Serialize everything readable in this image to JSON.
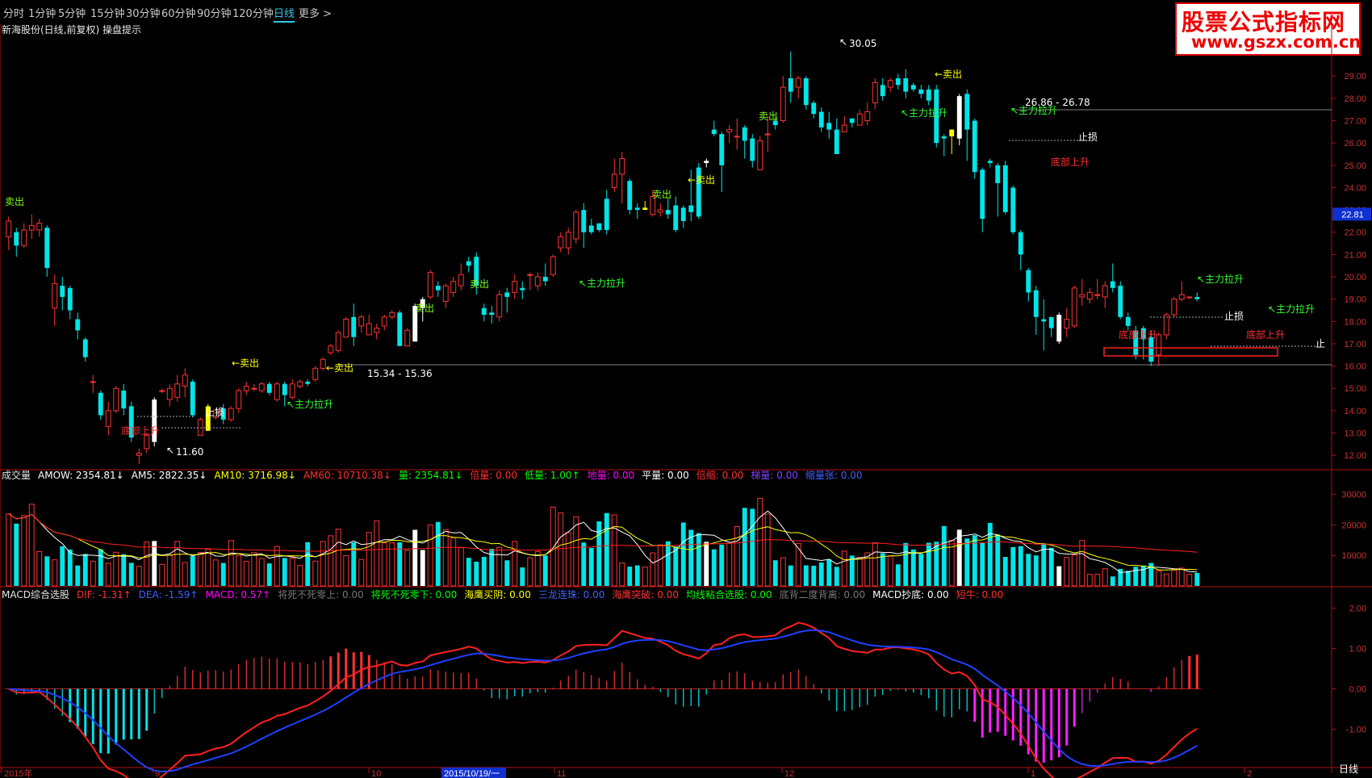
{
  "tabs": [
    "分时",
    "1分钟",
    "5分钟",
    "15分钟",
    "30分钟",
    "60分钟",
    "90分钟",
    "120分钟",
    "日线",
    "更多 >"
  ],
  "active_tab": "日线",
  "logo": {
    "line1": "股票公式指标网",
    "line2": "www.gszx.com.cn"
  },
  "title": "新海股份(日线,前复权) 操盘提示",
  "price_axis": {
    "ticks": [
      "29.00",
      "28.00",
      "27.00",
      "26.00",
      "25.00",
      "24.00",
      "23.00",
      "22.00",
      "21.00",
      "20.00",
      "19.00",
      "18.00",
      "17.00",
      "16.00",
      "15.00",
      "14.00",
      "13.00",
      "12.00"
    ],
    "current": "22.81"
  },
  "date_axis": [
    "2015年",
    "9",
    "10",
    "2015/10/19/一",
    "11",
    "12",
    "1",
    "2"
  ],
  "bottom_right": "日线",
  "volume_axis": [
    "30000",
    "20000",
    "10000"
  ],
  "macd_axis": [
    "2.00",
    "1.00",
    "0.00",
    "-1.00"
  ],
  "volume_header": [
    {
      "text": "成交量",
      "color": "#e6e6e6"
    },
    {
      "text": "AMOW: 2354.81↓",
      "color": "#ffffff"
    },
    {
      "text": "AM5: 2822.35↓",
      "color": "#ffffff"
    },
    {
      "text": "AM10: 3716.98↓",
      "color": "#ffff00"
    },
    {
      "text": "AM60: 10710.38↓",
      "color": "#ff3030"
    },
    {
      "text": "量: 2354.81↓",
      "color": "#00ff00"
    },
    {
      "text": "倍量: 0.00",
      "color": "#ff3030"
    },
    {
      "text": "低量: 1.00↑",
      "color": "#00ff00"
    },
    {
      "text": "地量: 0.00",
      "color": "#ff00ff"
    },
    {
      "text": "平量: 0.00",
      "color": "#ffffff"
    },
    {
      "text": "倍缩: 0.00",
      "color": "#ff3030"
    },
    {
      "text": "梯量: 0.00",
      "color": "#8040ff"
    },
    {
      "text": "缩量张: 0.00",
      "color": "#4060ff"
    }
  ],
  "macd_header": [
    {
      "text": "MACD综合选股",
      "color": "#e6e6e6"
    },
    {
      "text": "DIF: -1.31↑",
      "color": "#ff3030"
    },
    {
      "text": "DEA: -1.59↑",
      "color": "#4060ff"
    },
    {
      "text": "MACD: 0.57↑",
      "color": "#ff00ff"
    },
    {
      "text": "将死不死零上: 0.00",
      "color": "#777777"
    },
    {
      "text": "将死不死零下: 0.00",
      "color": "#00ff00"
    },
    {
      "text": "海鹰买阴: 0.00",
      "color": "#ffff00"
    },
    {
      "text": "三龙连珠: 0.00",
      "color": "#4060ff"
    },
    {
      "text": "海鹰突破: 0.00",
      "color": "#ff3030"
    },
    {
      "text": "均线粘合选股: 0.00",
      "color": "#00ff00"
    },
    {
      "text": "底背二度背离: 0.00",
      "color": "#777777"
    },
    {
      "text": "MACD抄底: 0.00",
      "color": "#ffffff"
    },
    {
      "text": "短牛: 0.00",
      "color": "#ff3030"
    }
  ],
  "annotations": {
    "sell": "←卖出",
    "sell_label": "卖出",
    "main_rise": "主力拉升",
    "stop_loss": "止损",
    "bottom_rise": "底部上升",
    "high": "30.05",
    "low": "11.60",
    "range1": "15.34 - 15.36",
    "range2": "26.86 - 26.78",
    "zhi": "止",
    "sell_green_1": "卖出",
    "sell_green_2": "卖出",
    "sell_green_3": "卖出",
    "sell_green_4": "卖出"
  },
  "chart_data": {
    "type": "candlestick",
    "ylim": [
      11.5,
      30.6
    ],
    "candles": [
      [
        21.8,
        22.5,
        21.2,
        22.7
      ],
      [
        22.0,
        21.4,
        20.9,
        22.2
      ],
      [
        21.4,
        22.1,
        21.3,
        22.4
      ],
      [
        22.1,
        22.3,
        21.7,
        22.8
      ],
      [
        22.1,
        22.4,
        21.8,
        22.6
      ],
      [
        22.2,
        20.4,
        20.0,
        22.3
      ],
      [
        18.6,
        19.7,
        17.8,
        20.1
      ],
      [
        19.6,
        19.1,
        18.5,
        20.0
      ],
      [
        19.5,
        18.5,
        18.1,
        19.6
      ],
      [
        18.1,
        17.6,
        17.2,
        18.4
      ],
      [
        17.2,
        16.4,
        16.2,
        17.3
      ],
      [
        15.3,
        15.3,
        14.8,
        15.6
      ],
      [
        14.8,
        13.8,
        13.6,
        14.9
      ],
      [
        13.3,
        14.0,
        12.9,
        14.4
      ],
      [
        14.0,
        15.0,
        13.9,
        15.1
      ],
      [
        14.9,
        14.1,
        13.8,
        15.2
      ],
      [
        14.2,
        12.8,
        12.6,
        14.4
      ],
      [
        12.0,
        12.1,
        11.6,
        12.3
      ],
      [
        12.3,
        12.9,
        12.1,
        13.0
      ],
      [
        12.6,
        14.5,
        12.4,
        14.6
      ],
      [
        14.9,
        14.9,
        14.8,
        15.0
      ],
      [
        14.5,
        15.0,
        14.2,
        15.2
      ],
      [
        14.6,
        15.2,
        14.4,
        15.6
      ],
      [
        15.1,
        15.6,
        14.6,
        15.9
      ],
      [
        15.3,
        13.8,
        13.7,
        15.4
      ],
      [
        12.9,
        13.6,
        12.9,
        13.7
      ],
      [
        13.1,
        14.2,
        13.1,
        14.3
      ],
      [
        13.7,
        14.0,
        13.6,
        14.1
      ],
      [
        14.1,
        13.6,
        13.4,
        14.3
      ],
      [
        13.6,
        14.1,
        13.5,
        14.2
      ],
      [
        14.1,
        14.9,
        13.9,
        15.0
      ],
      [
        14.9,
        15.1,
        14.7,
        15.3
      ],
      [
        15.0,
        15.0,
        14.9,
        15.2
      ],
      [
        14.9,
        15.2,
        14.8,
        15.3
      ],
      [
        15.2,
        14.8,
        14.7,
        15.3
      ],
      [
        14.5,
        15.2,
        14.4,
        15.3
      ],
      [
        15.2,
        14.7,
        14.2,
        15.3
      ],
      [
        14.6,
        15.2,
        14.5,
        15.4
      ],
      [
        15.1,
        15.3,
        15.0,
        15.4
      ],
      [
        15.3,
        15.2,
        15.1,
        15.4
      ],
      [
        15.4,
        15.9,
        15.3,
        16.0
      ],
      [
        15.9,
        16.3,
        15.8,
        16.4
      ],
      [
        16.6,
        16.9,
        16.5,
        17.0
      ],
      [
        16.7,
        17.5,
        16.6,
        17.6
      ],
      [
        17.3,
        18.1,
        17.3,
        18.2
      ],
      [
        18.2,
        17.3,
        16.9,
        18.8
      ],
      [
        17.8,
        18.2,
        17.5,
        18.3
      ],
      [
        17.4,
        17.9,
        17.4,
        18.3
      ],
      [
        17.5,
        17.7,
        17.2,
        17.9
      ],
      [
        17.8,
        18.2,
        17.6,
        18.3
      ],
      [
        18.2,
        18.4,
        18.1,
        18.5
      ],
      [
        18.4,
        16.9,
        16.9,
        18.5
      ],
      [
        16.9,
        17.6,
        16.9,
        17.7
      ],
      [
        17.1,
        18.7,
        17.1,
        18.8
      ],
      [
        19.0,
        18.6,
        18.0,
        19.1
      ],
      [
        19.1,
        20.2,
        19.0,
        20.3
      ],
      [
        19.6,
        19.4,
        19.1,
        19.8
      ],
      [
        18.9,
        19.6,
        18.6,
        19.7
      ],
      [
        19.3,
        19.8,
        19.1,
        20.0
      ],
      [
        19.6,
        20.1,
        19.4,
        20.6
      ],
      [
        20.7,
        20.5,
        20.2,
        20.9
      ],
      [
        20.9,
        19.6,
        19.2,
        21.1
      ],
      [
        18.6,
        18.3,
        18.0,
        18.8
      ],
      [
        18.4,
        18.3,
        17.9,
        18.7
      ],
      [
        18.2,
        19.2,
        18.0,
        19.4
      ],
      [
        19.3,
        19.1,
        18.4,
        19.5
      ],
      [
        19.3,
        19.8,
        19.0,
        20.1
      ],
      [
        19.5,
        19.4,
        19.0,
        19.8
      ],
      [
        20.1,
        20.1,
        19.4,
        20.2
      ],
      [
        19.6,
        20.0,
        19.4,
        20.2
      ],
      [
        20.0,
        19.8,
        19.6,
        20.6
      ],
      [
        20.1,
        20.9,
        20.0,
        21.0
      ],
      [
        21.3,
        21.8,
        21.1,
        22.0
      ],
      [
        21.3,
        22.0,
        21.0,
        22.2
      ],
      [
        21.7,
        22.9,
        21.5,
        23.0
      ],
      [
        23.0,
        22.0,
        21.3,
        23.3
      ],
      [
        22.3,
        22.0,
        21.9,
        22.6
      ],
      [
        22.4,
        22.1,
        22.0,
        22.4
      ],
      [
        23.5,
        22.1,
        21.9,
        23.9
      ],
      [
        24.0,
        24.6,
        23.8,
        25.3
      ],
      [
        24.6,
        25.3,
        23.3,
        25.6
      ],
      [
        24.3,
        23.0,
        22.8,
        24.4
      ],
      [
        23.1,
        23.0,
        22.6,
        23.3
      ],
      [
        23.0,
        23.1,
        23.0,
        23.4
      ],
      [
        22.8,
        23.6,
        22.7,
        23.9
      ],
      [
        22.9,
        23.0,
        22.7,
        23.3
      ],
      [
        23.0,
        22.8,
        22.6,
        23.5
      ],
      [
        23.2,
        22.1,
        22.0,
        23.6
      ],
      [
        23.1,
        22.5,
        22.2,
        23.2
      ],
      [
        23.2,
        22.9,
        22.5,
        24.8
      ],
      [
        24.9,
        22.7,
        22.6,
        25.1
      ],
      [
        25.2,
        25.1,
        24.9,
        25.3
      ],
      [
        26.6,
        26.4,
        26.3,
        27.0
      ],
      [
        26.4,
        25.0,
        23.8,
        26.5
      ],
      [
        26.5,
        26.6,
        26.0,
        26.8
      ],
      [
        26.3,
        26.3,
        25.7,
        27.1
      ],
      [
        26.7,
        26.1,
        25.3,
        26.8
      ],
      [
        26.2,
        25.2,
        24.9,
        26.4
      ],
      [
        24.8,
        26.1,
        24.8,
        26.3
      ],
      [
        26.4,
        26.4,
        25.6,
        27.2
      ],
      [
        27.0,
        26.8,
        26.6,
        27.2
      ],
      [
        27.0,
        28.5,
        26.9,
        29.0
      ],
      [
        28.9,
        28.3,
        27.8,
        30.1
      ],
      [
        28.5,
        28.9,
        28.0,
        29.0
      ],
      [
        28.9,
        27.7,
        27.5,
        29.0
      ],
      [
        27.8,
        27.3,
        27.1,
        27.9
      ],
      [
        27.4,
        26.7,
        26.5,
        27.6
      ],
      [
        26.9,
        26.6,
        26.2,
        27.4
      ],
      [
        26.6,
        25.5,
        25.5,
        27.1
      ],
      [
        26.5,
        26.8,
        26.5,
        27.2
      ],
      [
        27.1,
        26.9,
        26.7,
        27.1
      ],
      [
        26.8,
        27.3,
        26.8,
        27.5
      ],
      [
        27.0,
        27.4,
        26.8,
        27.8
      ],
      [
        27.8,
        28.7,
        27.5,
        28.9
      ],
      [
        28.6,
        28.1,
        27.9,
        28.9
      ],
      [
        28.5,
        28.8,
        28.3,
        28.9
      ],
      [
        28.9,
        28.6,
        28.4,
        29.1
      ],
      [
        28.9,
        28.3,
        28.0,
        29.3
      ],
      [
        28.6,
        28.4,
        28.3,
        28.7
      ],
      [
        28.4,
        28.2,
        28.0,
        28.6
      ],
      [
        28.4,
        27.9,
        27.7,
        28.6
      ],
      [
        28.4,
        26.0,
        25.8,
        28.6
      ],
      [
        26.3,
        26.2,
        25.4,
        26.4
      ],
      [
        26.3,
        26.6,
        25.5,
        26.6
      ],
      [
        26.2,
        28.1,
        25.9,
        28.2
      ],
      [
        28.2,
        26.6,
        25.2,
        28.4
      ],
      [
        27.0,
        24.7,
        24.4,
        27.1
      ],
      [
        24.8,
        22.6,
        22.0,
        24.9
      ],
      [
        25.2,
        25.1,
        24.9,
        25.3
      ],
      [
        25.0,
        24.2,
        22.7,
        25.1
      ],
      [
        25.0,
        22.9,
        22.8,
        25.2
      ],
      [
        24.0,
        22.0,
        21.9,
        24.1
      ],
      [
        22.0,
        21.0,
        20.3,
        22.1
      ],
      [
        20.3,
        19.3,
        18.9,
        20.4
      ],
      [
        19.4,
        18.2,
        17.4,
        19.6
      ],
      [
        18.1,
        18.0,
        16.7,
        19.0
      ],
      [
        18.2,
        17.7,
        17.3,
        18.2
      ],
      [
        18.3,
        17.1,
        17.0,
        18.4
      ],
      [
        17.7,
        18.1,
        17.3,
        18.6
      ],
      [
        17.8,
        19.5,
        17.7,
        19.6
      ],
      [
        19.1,
        19.2,
        18.7,
        19.9
      ],
      [
        19.0,
        19.3,
        18.8,
        19.5
      ],
      [
        19.2,
        19.2,
        19.0,
        19.9
      ],
      [
        19.1,
        19.6,
        18.6,
        19.8
      ],
      [
        19.8,
        19.5,
        19.3,
        20.6
      ],
      [
        19.6,
        18.2,
        18.1,
        19.8
      ],
      [
        18.2,
        17.8,
        17.6,
        18.4
      ],
      [
        17.6,
        16.5,
        16.3,
        17.8
      ],
      [
        17.7,
        17.2,
        16.3,
        17.8
      ],
      [
        17.3,
        16.2,
        16.0,
        17.6
      ],
      [
        16.5,
        17.4,
        16.0,
        17.5
      ],
      [
        17.4,
        18.3,
        17.2,
        18.4
      ],
      [
        18.3,
        19.0,
        18.2,
        19.1
      ],
      [
        19.0,
        19.2,
        18.9,
        19.8
      ],
      [
        19.1,
        19.1,
        19.0,
        19.1
      ],
      [
        19.1,
        19.0,
        18.9,
        19.3
      ]
    ]
  }
}
